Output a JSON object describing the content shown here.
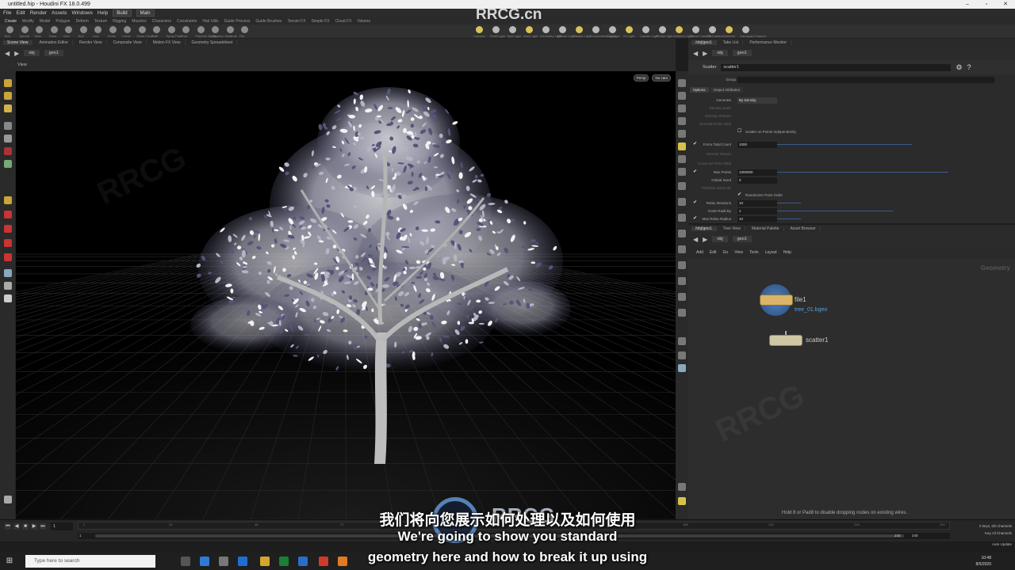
{
  "window": {
    "title": "untitled.hip - Houdini FX 18.0.499"
  },
  "menubar": {
    "items": [
      "File",
      "Edit",
      "Render",
      "Assets",
      "Windows",
      "Help"
    ],
    "desktop": "Build",
    "layout": "Main"
  },
  "shelf_tabs": [
    "Create",
    "Modify",
    "Model",
    "Polygon",
    "Deform",
    "Texture",
    "Rigging",
    "Muscles",
    "Characters",
    "Constraints",
    "Hair Utils",
    "Guide Process",
    "Guide Brushes",
    "Terrain FX",
    "Simple FX",
    "Cloud FX",
    "Volume"
  ],
  "shelf_tools": [
    "Box",
    "Sphere",
    "Tube",
    "Torus",
    "Grid",
    "Null",
    "Line",
    "Circle",
    "Curve",
    "Draw Curve",
    "Path",
    "Spray Paint",
    "Font",
    "Platonic Solids",
    "L-System",
    "Metaball",
    "File"
  ],
  "light_tools": [
    "Camera",
    "Point Light",
    "Spot Light",
    "Area Light",
    "Geometry Light",
    "Volume Light",
    "Distant Light",
    "Environment Light",
    "Sky Light",
    "GI Light",
    "Caustic Light",
    "Portal Light",
    "Ambient Light",
    "Stereo Camera",
    "VR Camera",
    "Switcher",
    "Gamepad Camera"
  ],
  "left_tabs": [
    "Scene View",
    "Animation Editor",
    "Render View",
    "Composite View",
    "Motion FX View",
    "Geometry Spreadsheet"
  ],
  "left_path": {
    "net": "obj",
    "node": "geo1"
  },
  "viewport": {
    "label": "View",
    "persp": "Persp",
    "cam": "No cam"
  },
  "right_tabs": [
    "/obj/geo1",
    "Take List",
    "Performance Monitor"
  ],
  "right_path": {
    "net": "obj",
    "node": "geo1"
  },
  "params": {
    "node_type": "Scatter",
    "node_name": "scatter1",
    "group_label": "Group",
    "tabs": [
      "Options",
      "Output Attributes"
    ],
    "generate_label": "Generate",
    "generate_value": "By Density",
    "density_scale": "Density Scale",
    "density_attribute": "Density Attribute",
    "override_point_attrib": "Override Point Attrib",
    "scatter_prims": "Scatter on Points Independently",
    "force_total_count": "Force Total Count",
    "force_total_count_value": "1000",
    "density_texture": "Density Texture",
    "count_per_prim": "Count per Prim Attrib",
    "max_points": "Max Points",
    "max_points_value": "1000000",
    "global_seed": "Global Seed",
    "global_seed_value": "0",
    "prim_seed": "Primitive Seed Attr",
    "randomize_order": "Randomize Point Order",
    "relax_iterations": "Relax Iterations",
    "relax_iterations_value": "10",
    "scale_radii": "Scale Radii By",
    "scale_radii_value": "1",
    "max_relax_radius": "Max Relax Radius",
    "max_relax_radius_value": "10"
  },
  "network": {
    "tabs": [
      "/obj/geo1",
      "Tree View",
      "Material Palette",
      "Asset Browser"
    ],
    "path": {
      "net": "obj",
      "node": "geo1"
    },
    "menu": [
      "Add",
      "Edit",
      "Go",
      "View",
      "Tools",
      "Layout",
      "Help"
    ],
    "context": "Geometry",
    "nodes": [
      {
        "name": "file1",
        "sub": "tree_01.bgeo"
      },
      {
        "name": "scatter1",
        "sub": ""
      }
    ],
    "hint": "Hold 8 or Pad8 to disable dropping nodes on existing wires."
  },
  "timeline": {
    "frame": "1",
    "ticks": [
      "1",
      "24",
      "48",
      "72",
      "96",
      "120",
      "144",
      "168",
      "192",
      "216",
      "240"
    ],
    "start": "1",
    "end": "240",
    "end2": "240",
    "keys": "0 keys, 0/0 channels",
    "key_all": "Key All Channels",
    "auto_update": "Auto Update"
  },
  "taskbar": {
    "search": "Type here to search",
    "time": "10:48",
    "date": "8/5/2020"
  },
  "subtitles": {
    "zh": "我们将向您展示如何处理以及如何使用",
    "en1": "We're going to show you standard",
    "en2": "geometry here and how to break it up using"
  },
  "watermark": {
    "top": "RRCG.cn",
    "mid": "RRCG"
  },
  "colors": {
    "accent": "#3b5a8c",
    "node_file": "#d9b46a",
    "node_scatter": "#cfc7a3",
    "selected_ring": "#4f86c6"
  }
}
